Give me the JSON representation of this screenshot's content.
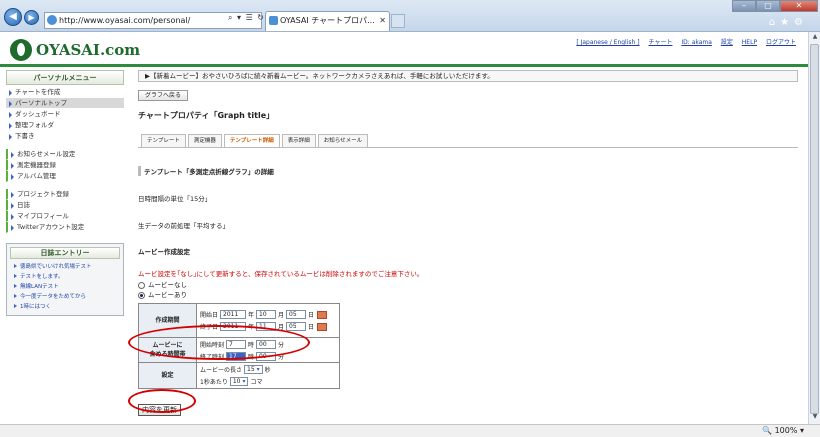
{
  "browser": {
    "url": "http://www.oyasai.com/personal/",
    "tab_title": "OYASAI チャートプロパ...",
    "toolbar_icons": [
      "home-icon",
      "star-icon",
      "gear-icon"
    ],
    "window_buttons": [
      "minimize",
      "maximize",
      "close"
    ],
    "zoom": "100%"
  },
  "site": {
    "logo": "OYASAI.com",
    "top_links": [
      "[ Japanese / English ]",
      "チャート",
      "ID: akama",
      "設定",
      "HELP",
      "ログアウト"
    ]
  },
  "sidebar": {
    "header": "パーソナルメニュー",
    "group1": [
      "チャートを作成",
      "パーソナルトップ",
      "ダッシュボード",
      "整理フォルダ",
      "下書き"
    ],
    "group2": [
      "お知らせメール設定",
      "測定機器登録",
      "アルバム管理"
    ],
    "group3": [
      "プロジェクト登録",
      "日誌",
      "マイプロフィール",
      "Twitterアカウント設定"
    ],
    "selected": "パーソナルトップ",
    "diary": {
      "header": "日誌エントリー",
      "items": [
        "徳島県でいいけれ気場テスト",
        "テストをします。",
        "無線LANテスト",
        "今一度データをためてから",
        "1時にはつく"
      ]
    }
  },
  "main": {
    "notice": "▶【新着ムービー】おやさいひろばに続々新着ムービー。ネットワークカメラさえあれば、手軽にお試しいただけます。",
    "back_button": "グラフへ戻る",
    "page_title": "チャートプロパティ「Graph title」",
    "tabs": [
      "テンプレート",
      "測定機器",
      "テンプレート詳細",
      "表示詳細",
      "お知らせメール"
    ],
    "active_tab": "テンプレート詳細",
    "template_section": "テンプレート「多測定点折線グラフ」の詳細",
    "interval_text": "日時間隔の単位「15分」",
    "raw_text": "生データの前処理「平均する」",
    "movie_section": "ムービー作成設定",
    "warning": "ムービ設定を｢なし｣にして更新すると、保存されているムービは削除されますのでご注意下さい。",
    "radio_none": "ムービーなし",
    "radio_yes": "ムービーあり",
    "period_label": "作成期間",
    "start_label": "開始日",
    "end_label": "終了日",
    "start_year": "2011",
    "start_month": "10",
    "start_day": "05",
    "end_year": "2011",
    "end_month": "11",
    "end_day": "05",
    "year_unit": "年",
    "month_unit": "月",
    "day_unit": "日",
    "time_label_1": "ムービーに",
    "time_label_2": "含める時間帯",
    "start_time_label": "開始時刻",
    "end_time_label": "終了時刻",
    "start_hour": "7",
    "start_min": "00",
    "end_hour": "17",
    "end_min": "00",
    "hour_unit": "時",
    "min_unit": "分",
    "settings_label": "設定",
    "movie_length_label": "ムービーの長さ",
    "movie_length": "15",
    "sec_unit": "秒",
    "per_sec_label": "1秒あたり",
    "frames": "10",
    "frame_unit": "コマ",
    "update_button": "内容を更新"
  }
}
